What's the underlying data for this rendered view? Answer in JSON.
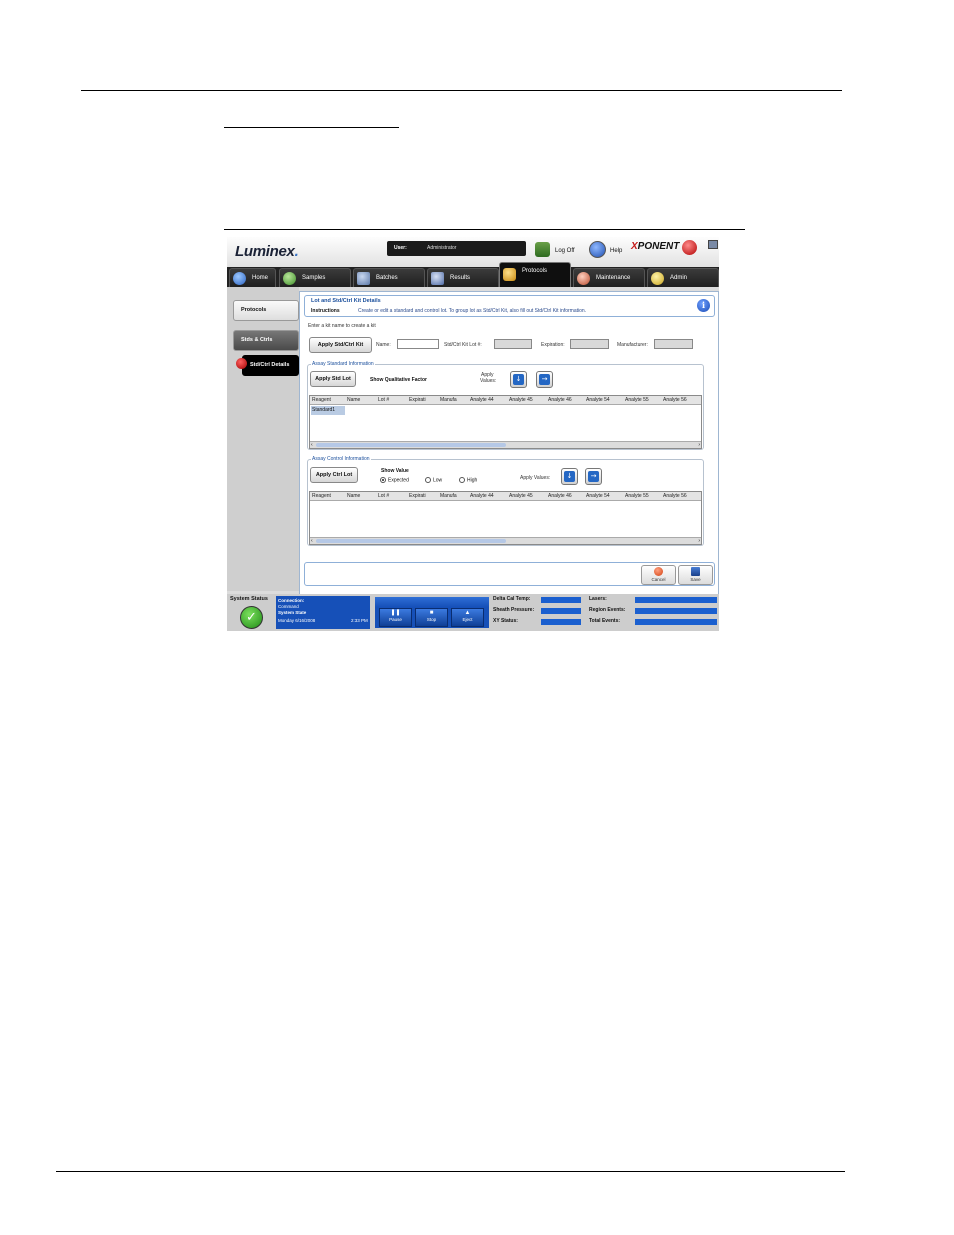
{
  "app": {
    "logo": "Luminex",
    "user_label": "User:",
    "user_value": "Administrator",
    "logoff": "Log Off",
    "help": "Help",
    "product": "PONENT",
    "product_prefix": "X"
  },
  "tabs": [
    {
      "label": "Home",
      "icon": "home-icon"
    },
    {
      "label": "Samples",
      "icon": "samples-icon"
    },
    {
      "label": "Batches",
      "icon": "batches-icon"
    },
    {
      "label": "Results",
      "icon": "results-icon"
    },
    {
      "label": "Protocols",
      "icon": "protocols-icon",
      "active": true
    },
    {
      "label": "Maintenance",
      "icon": "maintenance-icon"
    },
    {
      "label": "Admin",
      "icon": "admin-icon"
    }
  ],
  "sidenav": {
    "protocols": "Protocols",
    "stds": "Stds & Ctrls",
    "detail": "Std/Ctrl Details"
  },
  "panel": {
    "title": "Lot and Std/Ctrl Kit Details",
    "instructions_label": "Instructions",
    "instructions_text": "Create or edit a standard and control lot.  To group lot as Std/Ctrl Kit, also fill out Std/Ctrl Kit information.",
    "prompt": "Enter a kit name to create a kit",
    "apply_kit": "Apply Std/Ctrl Kit",
    "name_label": "Name:",
    "kit_lot_label": "Std/Ctrl Kit Lot #:",
    "expiration_label": "Expiration:",
    "manufacturer_label": "Manufacturer:"
  },
  "standard": {
    "group_label": "Assay Standard Information",
    "apply_btn": "Apply Std Lot",
    "qual_label": "Show Qualitative Factor",
    "apply_values_line1": "Apply",
    "apply_values_line2": "Values:",
    "columns": [
      "Reagent",
      "Name",
      "Lot #",
      "Expirati",
      "Manufa",
      "Analyte 44",
      "Analyte 45",
      "Analyte 46",
      "Analyte 54",
      "Analyte 55",
      "Analyte 56"
    ],
    "rows": [
      [
        "Standard1"
      ]
    ]
  },
  "control": {
    "group_label": "Assay Control Information",
    "apply_btn": "Apply Ctrl Lot",
    "show_value": "Show Value",
    "radios": [
      {
        "label": "Expected",
        "checked": true
      },
      {
        "label": "Low",
        "checked": false
      },
      {
        "label": "High",
        "checked": false
      }
    ],
    "apply_values": "Apply Values:",
    "columns": [
      "Reagent",
      "Name",
      "Lot #",
      "Expirati",
      "Manufa",
      "Analyte 44",
      "Analyte 45",
      "Analyte 46",
      "Analyte 54",
      "Analyte 55",
      "Analyte 56"
    ]
  },
  "actions": {
    "cancel": "Cancel",
    "save": "Save"
  },
  "status": {
    "system_status": "System Status",
    "connection": "Connection:",
    "connection_val": "Command",
    "system_state": "System State",
    "date": "Monday 6/16/2008",
    "time": "2:33 PM",
    "pause": "Pause",
    "stop": "Stop",
    "eject": "Eject",
    "delta_cal_temp": "Delta Cal Temp:",
    "sheath_pressure": "Sheath Pressure:",
    "xy_status": "XY Status:",
    "lasers": "Lasers:",
    "region_events": "Region Events:",
    "total_events": "Total Events:"
  }
}
